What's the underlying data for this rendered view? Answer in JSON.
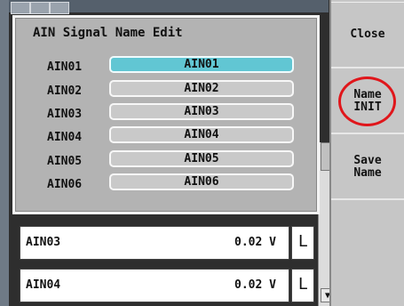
{
  "dialog": {
    "title": "AIN Signal Name Edit",
    "signals": [
      {
        "label": "AIN01",
        "value": "AIN01",
        "active": true
      },
      {
        "label": "AIN02",
        "value": "AIN02",
        "active": false
      },
      {
        "label": "AIN03",
        "value": "AIN03",
        "active": false
      },
      {
        "label": "AIN04",
        "value": "AIN04",
        "active": false
      },
      {
        "label": "AIN05",
        "value": "AIN05",
        "active": false
      },
      {
        "label": "AIN06",
        "value": "AIN06",
        "active": false
      }
    ]
  },
  "side_menu": {
    "close": "Close",
    "name_init": "Name\nINIT",
    "save_name": "Save\nName",
    "highlight_color": "#e0161b"
  },
  "list": {
    "rows": [
      {
        "name": "AIN03",
        "value": "0.02 V",
        "mode": "L"
      },
      {
        "name": "AIN04",
        "value": "0.02 V",
        "mode": "L"
      }
    ]
  },
  "colors": {
    "active_field": "#61c6d3",
    "dialog_bg": "#b3b3b3",
    "panel_bg": "#c6c6c6"
  }
}
